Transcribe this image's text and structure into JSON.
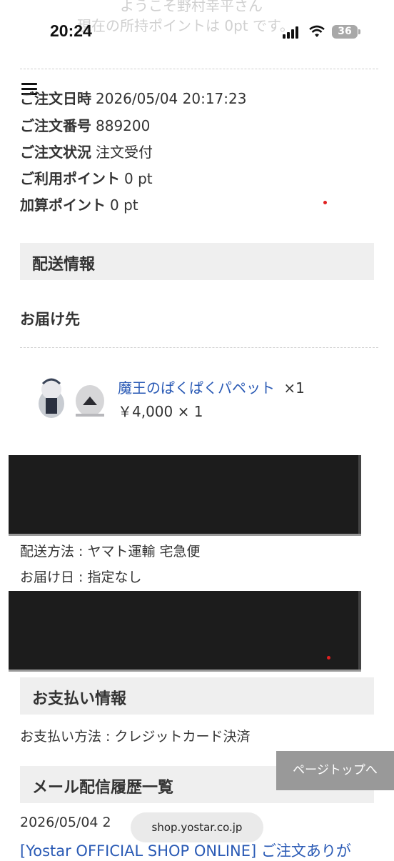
{
  "status_bar": {
    "time": "20:24",
    "battery": "36"
  },
  "header": {
    "welcome_text": "ようこそ野村幸平さん",
    "points_text": "現在の所持ポイントは 0pt です。"
  },
  "order": {
    "date_label": "ご注文日時",
    "date_value": "2026/05/04 20:17:23",
    "number_label": "ご注文番号",
    "number_value": "889200",
    "status_label": "ご注文状況",
    "status_value": "注文受付",
    "used_points_label": "ご利用ポイント",
    "used_points_value": "0 pt",
    "added_points_label": "加算ポイント",
    "added_points_value": "0 pt"
  },
  "shipping": {
    "section_title": "配送情報",
    "destination_label": "お届け先",
    "product_name": "魔王のぱくぱくパペット",
    "product_qty": "×1",
    "product_price": "￥4,000 × 1",
    "method": "配送方法 : ヤマト運輸 宅急便",
    "delivery_date": "お届け日 : 指定なし"
  },
  "payment": {
    "section_title": "お支払い情報",
    "method": "お支払い方法 : クレジットカード決済"
  },
  "mail": {
    "section_title": "メール配信履歴一覧",
    "date": "2026/05/04 2",
    "title": "[Yostar OFFICIAL SHOP ONLINE] ご注文ありが"
  },
  "page_top_button": "ページトップへ",
  "url": "shop.yostar.co.jp",
  "colors": {
    "link": "#2a5ab5",
    "section_bg": "#efefef",
    "page_top_bg": "#999999"
  }
}
